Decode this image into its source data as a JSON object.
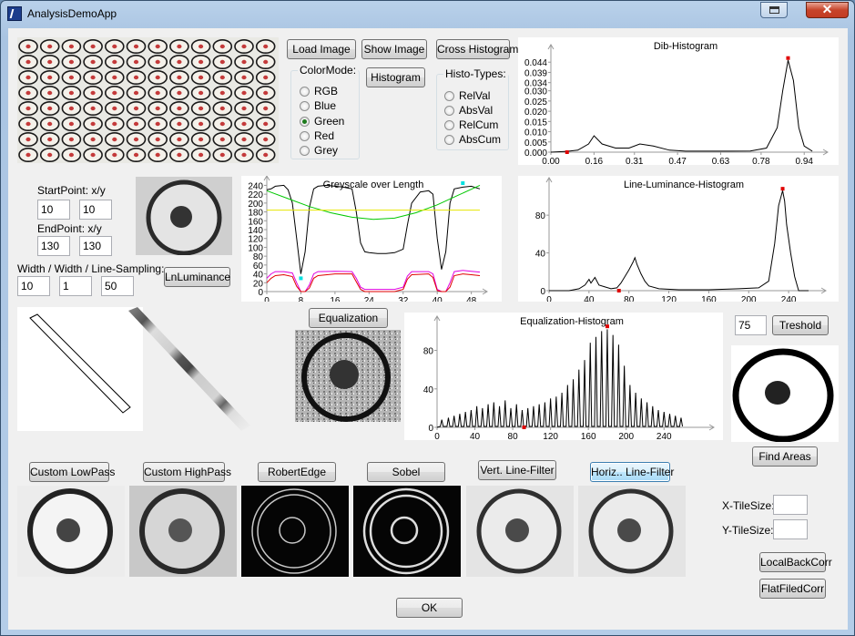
{
  "window": {
    "title": "AnalysisDemoApp",
    "close_glyph": "✕"
  },
  "buttons": {
    "load_image": "Load Image",
    "show_image": "Show Image",
    "cross_histogram": "Cross Histogram",
    "histogram": "Histogram",
    "ln_luminance": "LnLuminance",
    "equalization": "Equalization",
    "treshold": "Treshold",
    "find_areas": "Find Areas",
    "custom_lowpass": "Custom LowPass",
    "custom_highpass": "Custom HighPass",
    "robert_edge": "RobertEdge",
    "sobel": "Sobel",
    "vert_line_filter": "Vert. Line-Filter",
    "horiz_line_filter": "Horiz.. Line-Filter",
    "local_back_corr": "LocalBackCorr",
    "flat_filed_corr": "FlatFiledCorr",
    "ok": "OK"
  },
  "color_mode": {
    "title": "ColorMode:",
    "options": [
      "RGB",
      "Blue",
      "Green",
      "Red",
      "Grey"
    ],
    "selected": "Green"
  },
  "histo_types": {
    "title": "Histo-Types:",
    "options": [
      "RelVal",
      "AbsVal",
      "RelCum",
      "AbsCum"
    ]
  },
  "line_params": {
    "start_label": "StartPoint: x/y",
    "start_x": "10",
    "start_y": "10",
    "end_label": "EndPoint: x/y",
    "end_x": "130",
    "end_y": "130",
    "width_label": "Width / Width / Line-Sampling:",
    "width1": "10",
    "width2": "1",
    "sampling": "50"
  },
  "treshold_value": "75",
  "tiles": {
    "x_label": "X-TileSize:",
    "y_label": "Y-TileSize:",
    "x_value": "",
    "y_value": ""
  },
  "colors": {
    "accent_red": "#e00000",
    "cyan_marker": "#00e0e0",
    "green_curve": "#00c800",
    "yellow_line": "#e6e600",
    "magenta_curve": "#e000e0"
  },
  "chart_data": [
    {
      "type": "line",
      "title": "Dib-Histogram",
      "x_ticks": [
        "0.00",
        "0.16",
        "0.31",
        "0.47",
        "0.63",
        "0.78",
        "0.94"
      ],
      "y_ticks": [
        "0.000",
        "0.005",
        "0.010",
        "0.015",
        "0.020",
        "0.025",
        "0.030",
        "0.034",
        "0.039",
        "0.044"
      ],
      "xlim": [
        0,
        1.0
      ],
      "ylim": [
        0,
        0.049
      ],
      "series": [
        {
          "x": [
            0.0,
            0.06,
            0.1,
            0.14,
            0.16,
            0.19,
            0.24,
            0.29,
            0.33,
            0.38,
            0.44,
            0.5,
            0.58,
            0.66,
            0.74,
            0.8,
            0.84,
            0.86,
            0.88,
            0.9,
            0.92,
            0.94,
            0.97
          ],
          "y": [
            0.0,
            0.0004,
            0.001,
            0.004,
            0.008,
            0.004,
            0.002,
            0.002,
            0.004,
            0.003,
            0.001,
            0.0005,
            0.0005,
            0.0005,
            0.0006,
            0.002,
            0.012,
            0.03,
            0.045,
            0.035,
            0.012,
            0.003,
            0.0005
          ]
        }
      ],
      "markers": [
        {
          "x": 0.06,
          "y": 0.0
        },
        {
          "x": 0.88,
          "y": 0.046
        }
      ]
    },
    {
      "type": "line",
      "title": "Greyscale over Length",
      "x_ticks": [
        "0",
        "8",
        "16",
        "24",
        "32",
        "40",
        "48"
      ],
      "y_ticks": [
        "0",
        "20",
        "40",
        "60",
        "80",
        "100",
        "120",
        "140",
        "160",
        "180",
        "200",
        "220",
        "240"
      ],
      "xlim": [
        0,
        50
      ],
      "ylim": [
        0,
        245
      ],
      "series": [
        {
          "color": "black",
          "x": [
            0,
            1,
            2,
            4,
            5,
            6,
            7,
            8,
            9,
            10,
            11,
            12,
            14,
            16,
            18,
            20,
            21,
            22,
            23,
            24,
            26,
            28,
            30,
            32,
            33,
            34,
            36,
            38,
            39,
            40,
            41,
            42,
            43,
            44,
            46,
            48,
            50
          ],
          "y": [
            230,
            232,
            238,
            240,
            230,
            200,
            120,
            40,
            90,
            190,
            232,
            238,
            240,
            238,
            236,
            232,
            180,
            110,
            90,
            88,
            86,
            86,
            88,
            96,
            150,
            200,
            225,
            228,
            220,
            120,
            50,
            90,
            200,
            232,
            236,
            238,
            232
          ]
        },
        {
          "color": "green",
          "x": [
            0,
            5,
            10,
            15,
            20,
            25,
            30,
            35,
            40,
            45,
            50
          ],
          "y": [
            228,
            210,
            192,
            178,
            168,
            163,
            166,
            178,
            196,
            218,
            240
          ]
        },
        {
          "color": "yellow",
          "x": [
            0,
            50
          ],
          "y": [
            184,
            184
          ]
        },
        {
          "color": "magenta",
          "x": [
            0,
            1,
            2,
            4,
            6,
            7,
            8,
            9,
            10,
            11,
            12,
            16,
            20,
            21,
            22,
            23,
            24,
            30,
            32,
            33,
            34,
            38,
            39,
            40,
            41,
            42,
            43,
            44,
            46,
            48,
            50
          ],
          "y": [
            30,
            40,
            45,
            45,
            42,
            20,
            0,
            0,
            15,
            40,
            45,
            46,
            45,
            30,
            10,
            5,
            5,
            5,
            10,
            35,
            45,
            45,
            40,
            5,
            0,
            0,
            20,
            45,
            48,
            46,
            44
          ]
        },
        {
          "color": "red",
          "x": [
            0,
            1,
            2,
            4,
            6,
            7,
            8,
            9,
            10,
            11,
            12,
            16,
            20,
            21,
            22,
            23,
            24,
            30,
            32,
            33,
            34,
            38,
            39,
            40,
            41,
            42,
            43,
            44,
            46,
            48,
            50
          ],
          "y": [
            20,
            30,
            36,
            38,
            34,
            12,
            0,
            0,
            8,
            30,
            36,
            40,
            40,
            22,
            5,
            0,
            0,
            0,
            5,
            28,
            38,
            40,
            32,
            2,
            0,
            0,
            10,
            36,
            40,
            38,
            36
          ]
        }
      ],
      "markers": [
        {
          "x": 8,
          "y": 30
        },
        {
          "x": 46,
          "y": 245
        }
      ]
    },
    {
      "type": "line",
      "title": "Line-Luminance-Histogram",
      "x_ticks": [
        "0",
        "40",
        "80",
        "120",
        "160",
        "200",
        "240"
      ],
      "y_ticks": [
        "0",
        "40",
        "80"
      ],
      "xlim": [
        0,
        270
      ],
      "ylim": [
        0,
        112
      ],
      "series": [
        {
          "x": [
            0,
            20,
            30,
            36,
            40,
            42,
            46,
            50,
            56,
            62,
            68,
            72,
            76,
            80,
            84,
            86,
            88,
            92,
            96,
            100,
            110,
            130,
            160,
            190,
            210,
            220,
            226,
            230,
            234,
            236,
            238,
            242,
            246,
            250,
            260
          ],
          "y": [
            0,
            0,
            2,
            6,
            12,
            8,
            14,
            6,
            4,
            2,
            3,
            8,
            15,
            22,
            30,
            35,
            28,
            18,
            10,
            5,
            2,
            1,
            1,
            2,
            3,
            10,
            50,
            90,
            106,
            95,
            70,
            40,
            15,
            0,
            0
          ]
        }
      ],
      "markers": [
        {
          "x": 70,
          "y": 0
        },
        {
          "x": 234,
          "y": 108
        }
      ]
    },
    {
      "type": "line",
      "title": "Equalization-Histogram",
      "x_ticks": [
        "0",
        "40",
        "80",
        "120",
        "160",
        "200",
        "240"
      ],
      "y_ticks": [
        "0",
        "40",
        "80"
      ],
      "xlim": [
        0,
        285
      ],
      "ylim": [
        0,
        108
      ],
      "spikes": {
        "x": [
          5,
          12,
          18,
          24,
          30,
          36,
          42,
          48,
          54,
          60,
          66,
          72,
          78,
          84,
          90,
          96,
          102,
          108,
          114,
          120,
          126,
          132,
          138,
          144,
          150,
          156,
          162,
          168,
          174,
          180,
          186,
          192,
          198,
          204,
          210,
          216,
          222,
          228,
          234,
          240,
          246,
          252,
          258
        ],
        "y": [
          8,
          10,
          12,
          14,
          16,
          18,
          22,
          20,
          24,
          26,
          22,
          28,
          20,
          24,
          18,
          20,
          22,
          24,
          26,
          30,
          32,
          36,
          44,
          50,
          60,
          70,
          88,
          94,
          100,
          102,
          96,
          86,
          64,
          44,
          36,
          30,
          26,
          22,
          18,
          16,
          14,
          12,
          10
        ]
      },
      "markers": [
        {
          "x": 92,
          "y": 0
        },
        {
          "x": 180,
          "y": 105
        }
      ]
    }
  ]
}
